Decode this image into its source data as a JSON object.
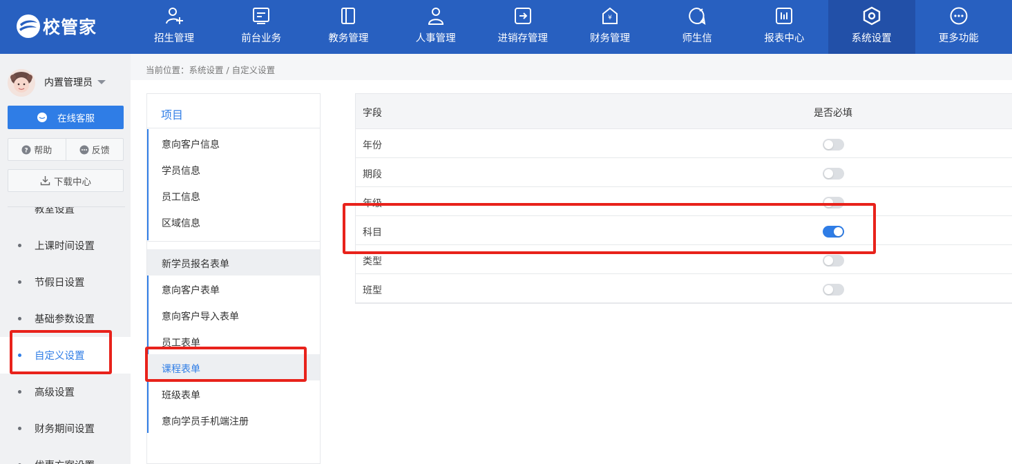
{
  "brand": {
    "name": "校管家",
    "color": "#2860c0"
  },
  "nav": {
    "items": [
      {
        "label": "招生管理",
        "icon": "user-add-icon"
      },
      {
        "label": "前台业务",
        "icon": "monitor-icon"
      },
      {
        "label": "教务管理",
        "icon": "book-icon"
      },
      {
        "label": "人事管理",
        "icon": "person-icon"
      },
      {
        "label": "进销存管理",
        "icon": "arrow-box-icon"
      },
      {
        "label": "财务管理",
        "icon": "yen-house-icon"
      },
      {
        "label": "师生信",
        "icon": "chat-bubble-icon"
      },
      {
        "label": "报表中心",
        "icon": "bar-report-icon"
      },
      {
        "label": "系统设置",
        "icon": "settings-hex-icon"
      },
      {
        "label": "更多功能",
        "icon": "more-dots-icon"
      }
    ],
    "active": "系统设置"
  },
  "user": {
    "name": "内置管理员"
  },
  "sidebar": {
    "service_label": "在线客服",
    "help_label": "帮助",
    "feedback_label": "反馈",
    "download_label": "下载中心",
    "menu": [
      {
        "label": "教室设置"
      },
      {
        "label": "上课时间设置"
      },
      {
        "label": "节假日设置"
      },
      {
        "label": "基础参数设置"
      },
      {
        "label": "自定义设置",
        "active": true
      },
      {
        "label": "高级设置"
      },
      {
        "label": "财务期间设置"
      },
      {
        "label": "优惠方案设置"
      }
    ]
  },
  "breadcrumb": {
    "text": "当前位置：系统设置 / 自定义设置"
  },
  "projects": {
    "title": "项目",
    "group1": [
      "意向客户信息",
      "学员信息",
      "员工信息",
      "区域信息"
    ],
    "group2": [
      "新学员报名表单",
      "意向客户表单",
      "意向客户导入表单",
      "员工表单",
      "课程表单",
      "班级表单",
      "意向学员手机端注册"
    ],
    "active": "课程表单"
  },
  "fields": {
    "header_field": "字段",
    "header_required": "是否必填",
    "rows": [
      {
        "name": "年份",
        "required": false
      },
      {
        "name": "期段",
        "required": false
      },
      {
        "name": "年级",
        "required": false
      },
      {
        "name": "科目",
        "required": true
      },
      {
        "name": "类型",
        "required": false
      },
      {
        "name": "班型",
        "required": false
      }
    ]
  },
  "colors": {
    "accent": "#2f7de6",
    "annotation": "#e8221b"
  }
}
